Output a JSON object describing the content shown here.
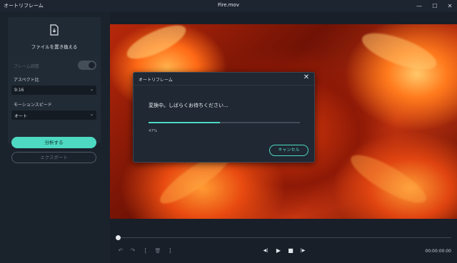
{
  "window": {
    "app_title": "オートリフレーム",
    "file_title": "Fire.mov",
    "minimize": "—",
    "maximize": "☐",
    "close": "✕"
  },
  "sidebar": {
    "replace_file_label": "ファイルを置き換える",
    "adjust_frame_label": "フレーム調整",
    "aspect_ratio_label": "アスペクト比",
    "aspect_ratio_value": "9:16",
    "motion_speed_label": "モーションスピード",
    "motion_speed_value": "オート",
    "analyze_button": "分析する",
    "export_button": "エクスポート",
    "chevron": "⌄"
  },
  "dialog": {
    "title": "オートリフレーム",
    "close": "✕",
    "message": "変換中。しばらくお待ちください...",
    "progress": 0.47,
    "progress_text": "47%",
    "cancel_button": "キャンセル"
  },
  "controls": {
    "undo": "↶",
    "redo": "↷",
    "mark_in": "[",
    "delete": "🗑",
    "mark_out": "]",
    "prev_frame": "◀|",
    "play": "▶",
    "stop": "■",
    "next_frame": "|▶",
    "timecode": "00:00:00:00"
  },
  "colors": {
    "accent": "#4ed9c2",
    "background": "#181f29",
    "panel": "#212b36"
  }
}
